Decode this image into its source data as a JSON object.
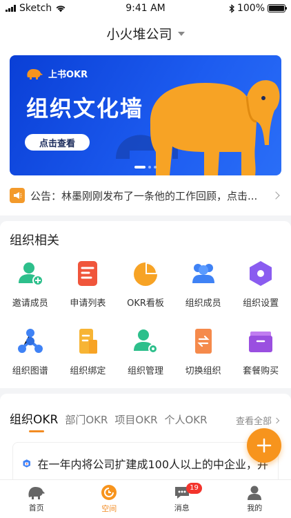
{
  "status_bar": {
    "carrier": "Sketch",
    "time": "9:41 AM",
    "battery": "100%"
  },
  "header": {
    "title": "小火堆公司"
  },
  "banner": {
    "brand": "上书OKR",
    "headline": "组织文化墙",
    "cta": "点击查看",
    "slide_count": 3,
    "active_slide": 1
  },
  "notice": {
    "text": "公告：林墨刚刚发布了一条他的工作回顾，点击..."
  },
  "org": {
    "title": "组织相关",
    "items": [
      {
        "label": "邀请成员",
        "icon": "invite-member-icon"
      },
      {
        "label": "申请列表",
        "icon": "application-list-icon"
      },
      {
        "label": "OKR看板",
        "icon": "okr-board-icon"
      },
      {
        "label": "组织成员",
        "icon": "org-members-icon"
      },
      {
        "label": "组织设置",
        "icon": "org-settings-icon"
      },
      {
        "label": "组织图谱",
        "icon": "org-graph-icon"
      },
      {
        "label": "组织绑定",
        "icon": "org-bind-icon"
      },
      {
        "label": "组织管理",
        "icon": "org-manage-icon"
      },
      {
        "label": "切换组织",
        "icon": "switch-org-icon"
      },
      {
        "label": "套餐购买",
        "icon": "package-buy-icon"
      }
    ]
  },
  "okr": {
    "tabs": [
      "组织OKR",
      "部门OKR",
      "项目OKR",
      "个人OKR"
    ],
    "view_all": "查看全部",
    "goal": "在一年内将公司扩建成100人以上的中企业，并"
  },
  "tabbar": {
    "items": [
      {
        "label": "首页"
      },
      {
        "label": "空间"
      },
      {
        "label": "消息",
        "badge": "19"
      },
      {
        "label": "我的"
      }
    ]
  },
  "colors": {
    "accent": "#F28B22",
    "banner_blue": "#1D5CF0",
    "badge_red": "#F3342C"
  }
}
